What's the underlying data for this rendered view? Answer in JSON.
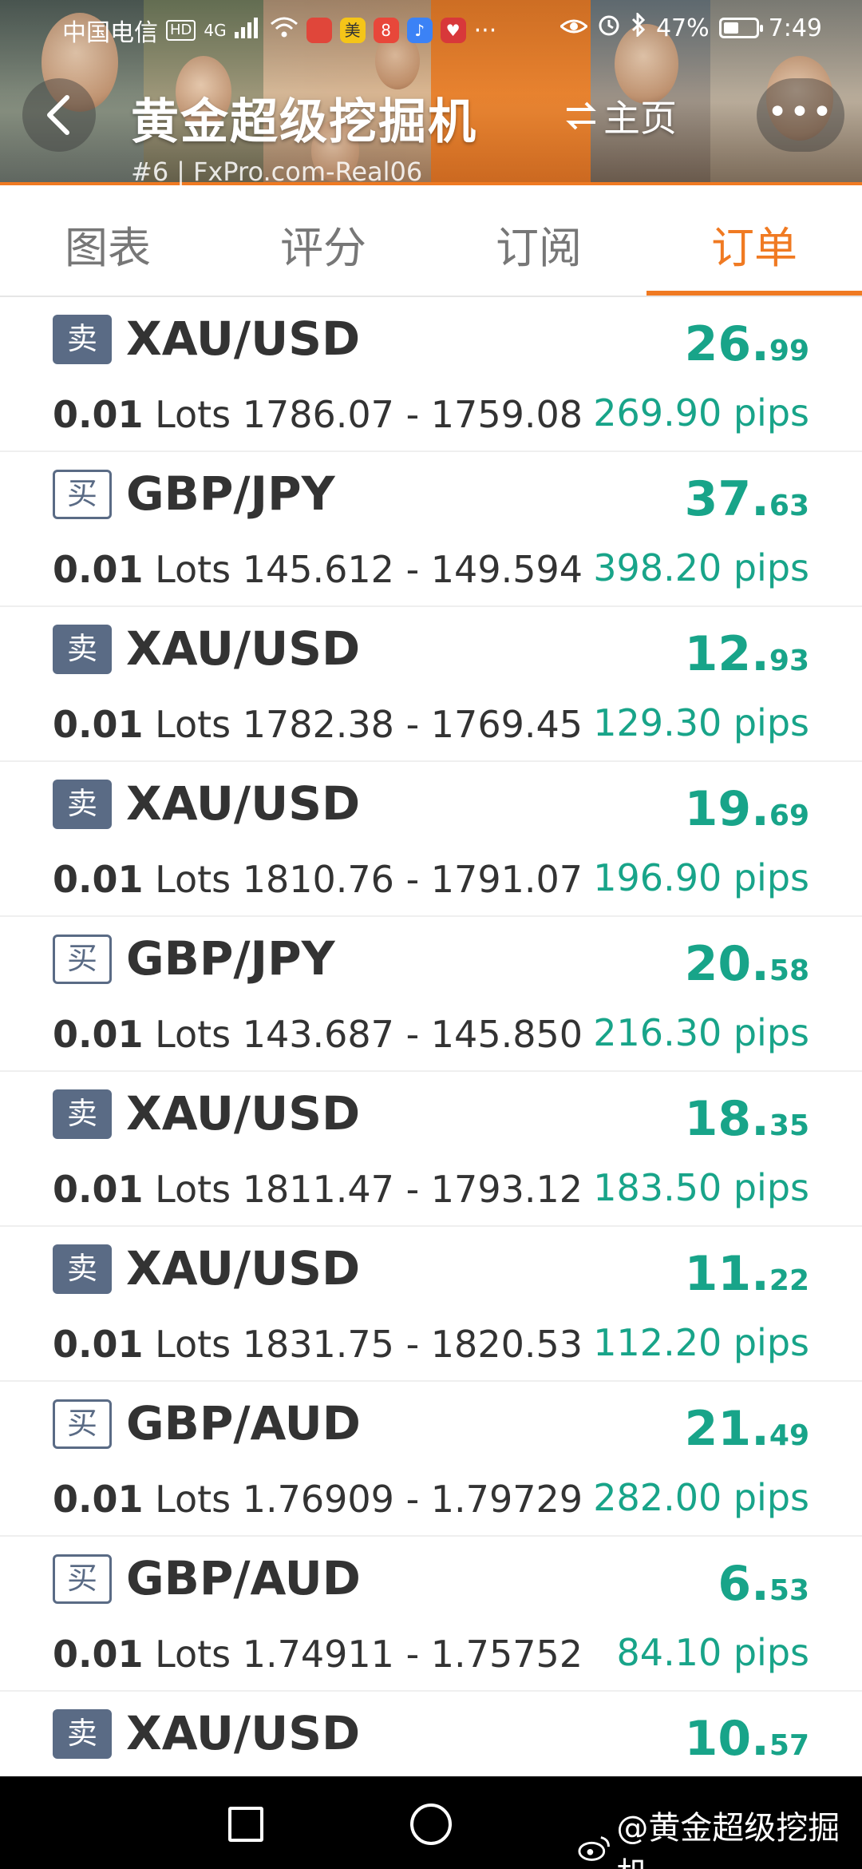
{
  "status_bar": {
    "carrier": "中国电信",
    "hd": "HD",
    "network": "4G",
    "apps": [
      "美",
      "8",
      "♪",
      "♥"
    ],
    "more": "···",
    "battery": "47%",
    "time": "7:49"
  },
  "header": {
    "title": "黄金超级挖掘机",
    "home_label": "主页",
    "more_label": "•••",
    "rank": "#6",
    "account": "FxPro.com-Real06"
  },
  "tabs": [
    {
      "label": "图表",
      "active": false
    },
    {
      "label": "评分",
      "active": false
    },
    {
      "label": "订阅",
      "active": false
    },
    {
      "label": "订单",
      "active": true
    }
  ],
  "colors": {
    "accent": "#f07a22",
    "profit": "#18a489",
    "badge": "#5a6b85"
  },
  "orders": [
    {
      "side": "卖",
      "type": "sell",
      "symbol": "XAU/USD",
      "lots": "0.01",
      "lots_unit": "Lots",
      "prices": "1786.07 - 1759.08",
      "profit_int": "26.",
      "profit_dec": "99",
      "pips": "269.90 pips"
    },
    {
      "side": "买",
      "type": "buy",
      "symbol": "GBP/JPY",
      "lots": "0.01",
      "lots_unit": "Lots",
      "prices": "145.612 - 149.594",
      "profit_int": "37.",
      "profit_dec": "63",
      "pips": "398.20 pips"
    },
    {
      "side": "卖",
      "type": "sell",
      "symbol": "XAU/USD",
      "lots": "0.01",
      "lots_unit": "Lots",
      "prices": "1782.38 - 1769.45",
      "profit_int": "12.",
      "profit_dec": "93",
      "pips": "129.30 pips"
    },
    {
      "side": "卖",
      "type": "sell",
      "symbol": "XAU/USD",
      "lots": "0.01",
      "lots_unit": "Lots",
      "prices": "1810.76 - 1791.07",
      "profit_int": "19.",
      "profit_dec": "69",
      "pips": "196.90 pips"
    },
    {
      "side": "买",
      "type": "buy",
      "symbol": "GBP/JPY",
      "lots": "0.01",
      "lots_unit": "Lots",
      "prices": "143.687 - 145.850",
      "profit_int": "20.",
      "profit_dec": "58",
      "pips": "216.30 pips"
    },
    {
      "side": "卖",
      "type": "sell",
      "symbol": "XAU/USD",
      "lots": "0.01",
      "lots_unit": "Lots",
      "prices": "1811.47 - 1793.12",
      "profit_int": "18.",
      "profit_dec": "35",
      "pips": "183.50 pips"
    },
    {
      "side": "卖",
      "type": "sell",
      "symbol": "XAU/USD",
      "lots": "0.01",
      "lots_unit": "Lots",
      "prices": "1831.75 - 1820.53",
      "profit_int": "11.",
      "profit_dec": "22",
      "pips": "112.20 pips"
    },
    {
      "side": "买",
      "type": "buy",
      "symbol": "GBP/AUD",
      "lots": "0.01",
      "lots_unit": "Lots",
      "prices": "1.76909 - 1.79729",
      "profit_int": "21.",
      "profit_dec": "49",
      "pips": "282.00 pips"
    },
    {
      "side": "买",
      "type": "buy",
      "symbol": "GBP/AUD",
      "lots": "0.01",
      "lots_unit": "Lots",
      "prices": "1.74911 - 1.75752",
      "profit_int": "6.",
      "profit_dec": "53",
      "pips": "84.10 pips"
    },
    {
      "side": "卖",
      "type": "sell",
      "symbol": "XAU/USD",
      "lots": "",
      "lots_unit": "",
      "prices": "",
      "profit_int": "10.",
      "profit_dec": "57",
      "pips": ""
    }
  ],
  "watermark": "@黄金超级挖掘机",
  "icons": {
    "back": "back-arrow-icon",
    "swap": "swap-arrows-icon",
    "more": "more-dots-icon",
    "recent": "recent-apps-square-icon",
    "home": "home-circle-icon",
    "weibo": "weibo-logo-icon"
  }
}
